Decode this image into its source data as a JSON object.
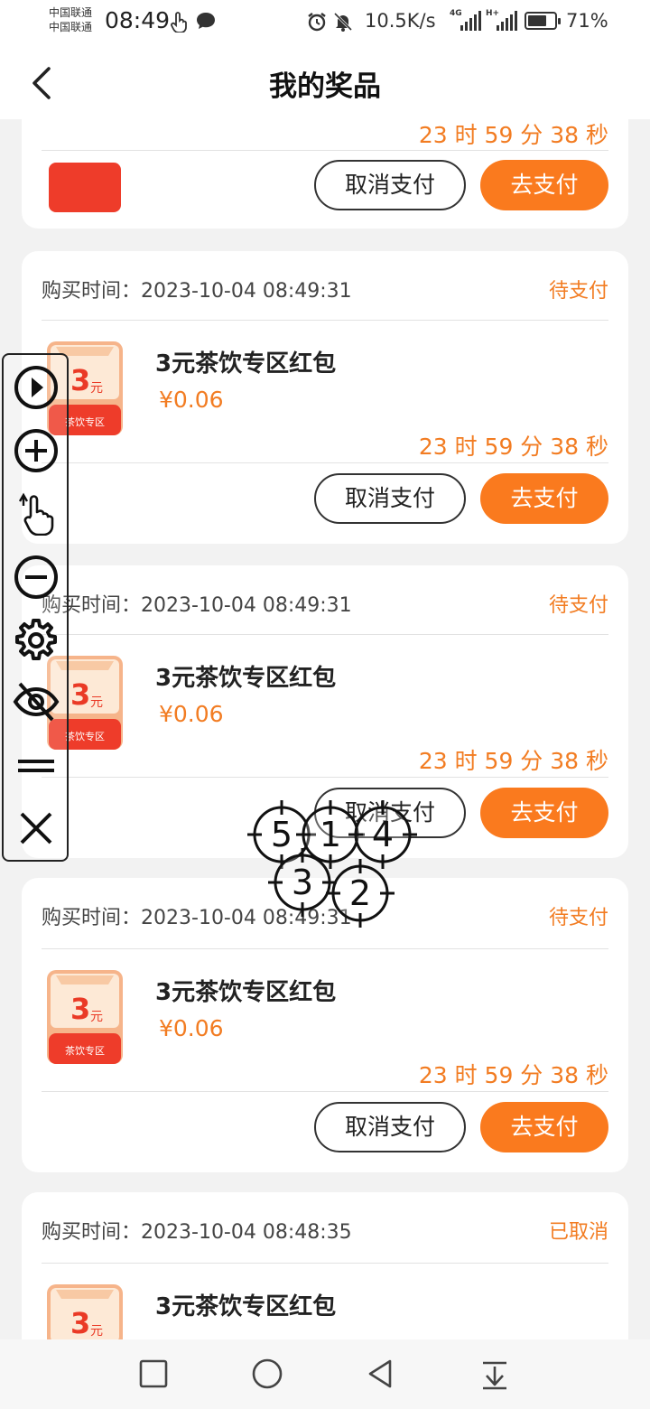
{
  "status_bar": {
    "carrier_1": "中国联通",
    "carrier_2": "中国联通",
    "time": "08:49",
    "net_speed": "10.5K/s",
    "net_type_1": "4G",
    "net_type_2": "H+",
    "battery": "71%",
    "battery_level": 0.71,
    "icons": [
      "hand-pointer-icon",
      "chat-bubble-icon",
      "alarm-icon",
      "bell-muted-icon",
      "signal-icon",
      "signal-icon",
      "battery-icon"
    ]
  },
  "header": {
    "title": "我的奖品",
    "back_icon": "chevron-left-icon"
  },
  "orders": [
    {
      "purchase_label": "",
      "purchase_time": "",
      "status": "",
      "product_name": "",
      "price": "",
      "countdown": "23 时 59 分 38 秒",
      "cancel_label": "取消支付",
      "pay_label": "去支付"
    },
    {
      "purchase_label": "购买时间：",
      "purchase_time": "2023-10-04 08:49:31",
      "status": "待支付",
      "product_name": "3元茶饮专区红包",
      "price": "¥0.06",
      "countdown": "23 时 59 分 38 秒",
      "cancel_label": "取消支付",
      "pay_label": "去支付"
    },
    {
      "purchase_label": "购买时间：",
      "purchase_time": "2023-10-04 08:49:31",
      "status": "待支付",
      "product_name": "3元茶饮专区红包",
      "price": "¥0.06",
      "countdown": "23 时 59 分 38 秒",
      "cancel_label": "取消支付",
      "pay_label": "去支付"
    },
    {
      "purchase_label": "购买时间：",
      "purchase_time": "2023-10-04 08:49:31",
      "status": "待支付",
      "product_name": "3元茶饮专区红包",
      "price": "¥0.06",
      "countdown": "23 时 59 分 38 秒",
      "cancel_label": "取消支付",
      "pay_label": "去支付"
    },
    {
      "purchase_label": "购买时间：",
      "purchase_time": "2023-10-04 08:48:35",
      "status": "已取消",
      "product_name": "3元茶饮专区红包",
      "price": "",
      "countdown": "",
      "cancel_label": "",
      "pay_label": ""
    }
  ],
  "coupon_image": {
    "amount": "3",
    "unit": "元",
    "caption": "茶饮专区"
  },
  "tool_panel": {
    "icons": [
      "play-icon",
      "zoom-in-icon",
      "tap-gesture-icon",
      "zoom-out-icon",
      "gear-icon",
      "eye-off-icon",
      "drag-handle-icon",
      "close-icon"
    ]
  },
  "touch_markers": [
    "5",
    "1",
    "4",
    "3",
    "2"
  ],
  "nav_bar": {
    "icons": [
      "recents-square-icon",
      "home-circle-icon",
      "back-triangle-icon",
      "notification-pulldown-icon"
    ]
  },
  "colors": {
    "accent": "#fa7a1e",
    "accent_text": "#f27c22",
    "background": "#f2f2f2"
  }
}
